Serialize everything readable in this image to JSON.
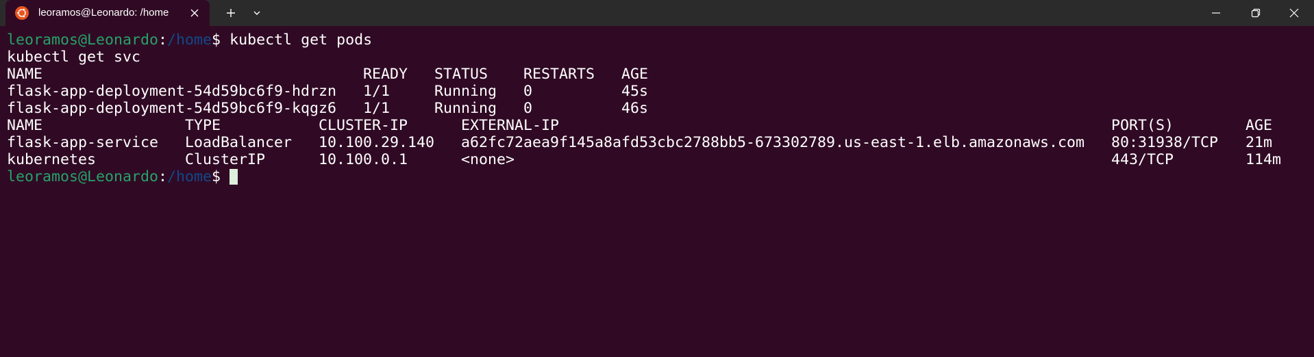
{
  "tab": {
    "title": "leoramos@Leonardo: /home",
    "icon": "ubuntu-icon"
  },
  "titlebar": {
    "new_tab_icon": "plus-icon",
    "dropdown_icon": "chevron-down-icon",
    "minimize_icon": "minimize-icon",
    "restore_icon": "restore-icon",
    "close_icon": "close-icon"
  },
  "colors": {
    "terminal_bg": "#300a24",
    "titlebar_bg": "#2b2b2b",
    "prompt_user": "#26a269",
    "prompt_path": "#12488b",
    "text": "#ffffff",
    "ubuntu_orange": "#e95420"
  },
  "terminal": {
    "prompt1": {
      "user": "leoramos@Leonardo",
      "colon": ":",
      "path": "/home",
      "symbol": "$ ",
      "command": "kubectl get pods"
    },
    "line2": "kubectl get svc",
    "pods": {
      "headers": [
        "NAME",
        "READY",
        "STATUS",
        "RESTARTS",
        "AGE"
      ],
      "rows": [
        [
          "flask-app-deployment-54d59bc6f9-hdrzn",
          "1/1",
          "Running",
          "0",
          "45s"
        ],
        [
          "flask-app-deployment-54d59bc6f9-kqgz6",
          "1/1",
          "Running",
          "0",
          "46s"
        ]
      ]
    },
    "svc": {
      "headers": [
        "NAME",
        "TYPE",
        "CLUSTER-IP",
        "EXTERNAL-IP",
        "PORT(S)",
        "AGE"
      ],
      "rows": [
        [
          "flask-app-service",
          "LoadBalancer",
          "10.100.29.140",
          "a62fc72aea9f145a8afd53cbc2788bb5-673302789.us-east-1.elb.amazonaws.com",
          "80:31938/TCP",
          "21m"
        ],
        [
          "kubernetes",
          "ClusterIP",
          "10.100.0.1",
          "<none>",
          "443/TCP",
          "114m"
        ]
      ]
    },
    "prompt2": {
      "user": "leoramos@Leonardo",
      "colon": ":",
      "path": "/home",
      "symbol": "$ "
    }
  }
}
